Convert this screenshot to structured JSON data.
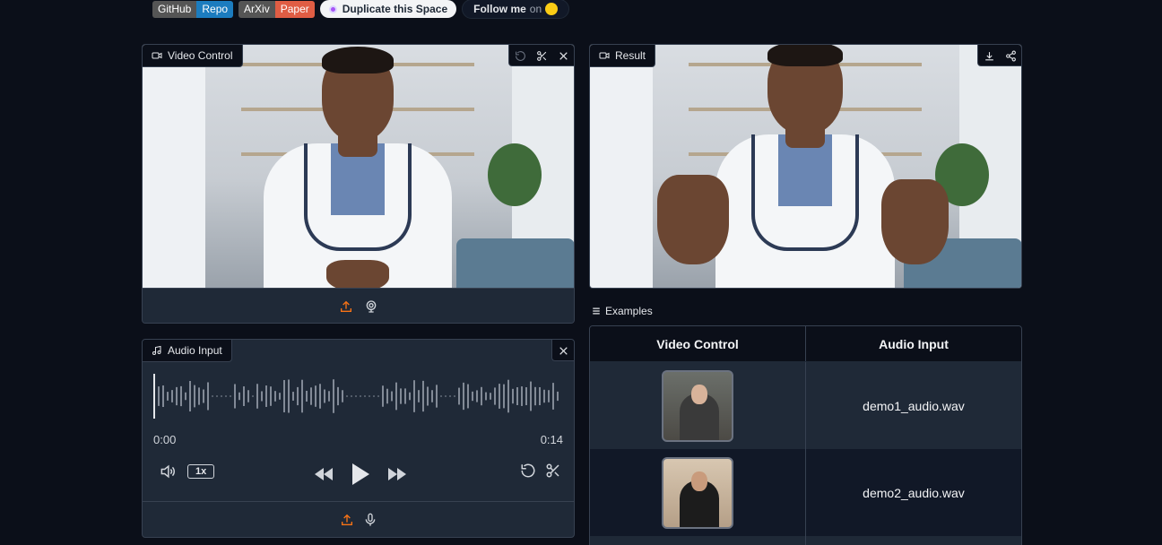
{
  "badges": {
    "github": {
      "left": "GitHub",
      "right": "Repo"
    },
    "arxiv": {
      "left": "ArXiv",
      "right": "Paper"
    },
    "duplicate_label": "Duplicate this Space",
    "follow_label": "Follow me",
    "follow_on": "on"
  },
  "video_panel": {
    "label": "Video Control"
  },
  "result_panel": {
    "label": "Result"
  },
  "audio_panel": {
    "label": "Audio Input",
    "time_start": "0:00",
    "time_end": "0:14",
    "rate": "1x"
  },
  "examples": {
    "label": "Examples",
    "columns": [
      "Video Control",
      "Audio Input"
    ],
    "rows": [
      {
        "audio": "demo1_audio.wav"
      },
      {
        "audio": "demo2_audio.wav"
      }
    ]
  },
  "icons": [
    "video-icon",
    "undo-icon",
    "scissors-icon",
    "close-icon",
    "download-icon",
    "share-icon",
    "upload-icon",
    "webcam-icon",
    "music-icon",
    "volume-icon",
    "rewind-icon",
    "play-icon",
    "fast-forward-icon",
    "microphone-icon",
    "list-icon"
  ],
  "colors": {
    "accent": "#f97316",
    "background": "#0b0f19",
    "panel": "#1f2937"
  }
}
